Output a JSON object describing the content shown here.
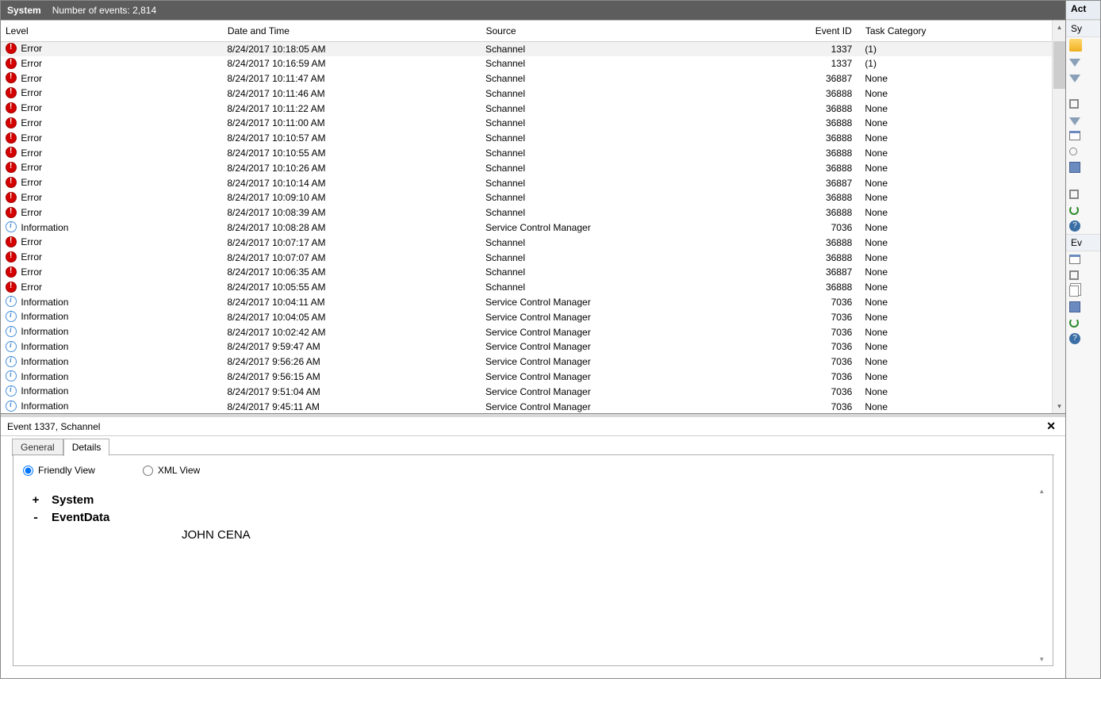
{
  "header": {
    "title": "System",
    "subtitle": "Number of events: 2,814"
  },
  "columns": {
    "level": "Level",
    "date": "Date and Time",
    "source": "Source",
    "eventid": "Event ID",
    "task": "Task Category"
  },
  "events": [
    {
      "level": "Error",
      "date": "8/24/2017 10:18:05 AM",
      "source": "Schannel",
      "eventid": "1337",
      "task": "(1)",
      "selected": true
    },
    {
      "level": "Error",
      "date": "8/24/2017 10:16:59 AM",
      "source": "Schannel",
      "eventid": "1337",
      "task": "(1)"
    },
    {
      "level": "Error",
      "date": "8/24/2017 10:11:47 AM",
      "source": "Schannel",
      "eventid": "36887",
      "task": "None"
    },
    {
      "level": "Error",
      "date": "8/24/2017 10:11:46 AM",
      "source": "Schannel",
      "eventid": "36888",
      "task": "None"
    },
    {
      "level": "Error",
      "date": "8/24/2017 10:11:22 AM",
      "source": "Schannel",
      "eventid": "36888",
      "task": "None"
    },
    {
      "level": "Error",
      "date": "8/24/2017 10:11:00 AM",
      "source": "Schannel",
      "eventid": "36888",
      "task": "None"
    },
    {
      "level": "Error",
      "date": "8/24/2017 10:10:57 AM",
      "source": "Schannel",
      "eventid": "36888",
      "task": "None"
    },
    {
      "level": "Error",
      "date": "8/24/2017 10:10:55 AM",
      "source": "Schannel",
      "eventid": "36888",
      "task": "None"
    },
    {
      "level": "Error",
      "date": "8/24/2017 10:10:26 AM",
      "source": "Schannel",
      "eventid": "36888",
      "task": "None"
    },
    {
      "level": "Error",
      "date": "8/24/2017 10:10:14 AM",
      "source": "Schannel",
      "eventid": "36887",
      "task": "None"
    },
    {
      "level": "Error",
      "date": "8/24/2017 10:09:10 AM",
      "source": "Schannel",
      "eventid": "36888",
      "task": "None"
    },
    {
      "level": "Error",
      "date": "8/24/2017 10:08:39 AM",
      "source": "Schannel",
      "eventid": "36888",
      "task": "None"
    },
    {
      "level": "Information",
      "date": "8/24/2017 10:08:28 AM",
      "source": "Service Control Manager",
      "eventid": "7036",
      "task": "None"
    },
    {
      "level": "Error",
      "date": "8/24/2017 10:07:17 AM",
      "source": "Schannel",
      "eventid": "36888",
      "task": "None"
    },
    {
      "level": "Error",
      "date": "8/24/2017 10:07:07 AM",
      "source": "Schannel",
      "eventid": "36888",
      "task": "None"
    },
    {
      "level": "Error",
      "date": "8/24/2017 10:06:35 AM",
      "source": "Schannel",
      "eventid": "36887",
      "task": "None"
    },
    {
      "level": "Error",
      "date": "8/24/2017 10:05:55 AM",
      "source": "Schannel",
      "eventid": "36888",
      "task": "None"
    },
    {
      "level": "Information",
      "date": "8/24/2017 10:04:11 AM",
      "source": "Service Control Manager",
      "eventid": "7036",
      "task": "None"
    },
    {
      "level": "Information",
      "date": "8/24/2017 10:04:05 AM",
      "source": "Service Control Manager",
      "eventid": "7036",
      "task": "None"
    },
    {
      "level": "Information",
      "date": "8/24/2017 10:02:42 AM",
      "source": "Service Control Manager",
      "eventid": "7036",
      "task": "None"
    },
    {
      "level": "Information",
      "date": "8/24/2017 9:59:47 AM",
      "source": "Service Control Manager",
      "eventid": "7036",
      "task": "None"
    },
    {
      "level": "Information",
      "date": "8/24/2017 9:56:26 AM",
      "source": "Service Control Manager",
      "eventid": "7036",
      "task": "None"
    },
    {
      "level": "Information",
      "date": "8/24/2017 9:56:15 AM",
      "source": "Service Control Manager",
      "eventid": "7036",
      "task": "None"
    },
    {
      "level": "Information",
      "date": "8/24/2017 9:51:04 AM",
      "source": "Service Control Manager",
      "eventid": "7036",
      "task": "None"
    },
    {
      "level": "Information",
      "date": "8/24/2017 9:45:11 AM",
      "source": "Service Control Manager",
      "eventid": "7036",
      "task": "None"
    }
  ],
  "detail": {
    "title": "Event 1337, Schannel",
    "tabs": {
      "general": "General",
      "details": "Details"
    },
    "radios": {
      "friendly": "Friendly View",
      "xml": "XML View"
    },
    "sections": {
      "system": {
        "toggle": "+",
        "name": "System"
      },
      "eventdata": {
        "toggle": "-",
        "name": "EventData",
        "value": "JOHN CENA"
      }
    }
  },
  "actions": {
    "header": "Act",
    "group1": "Sy",
    "group2": "Ev"
  }
}
